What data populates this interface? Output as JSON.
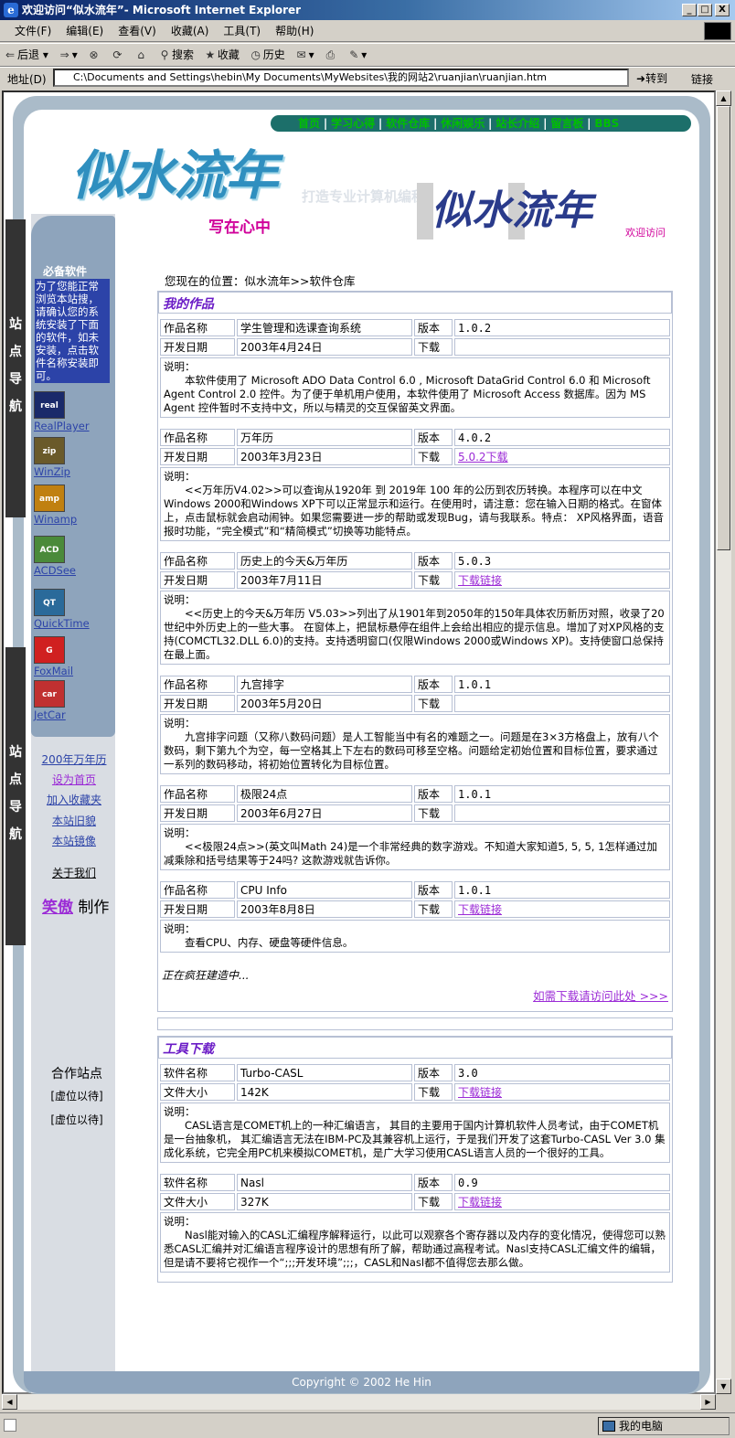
{
  "window": {
    "title": "欢迎访问“似水流年”- Microsoft Internet Explorer",
    "min": "_",
    "max": "□",
    "close": "X"
  },
  "menu": [
    "文件(F)",
    "编辑(E)",
    "查看(V)",
    "收藏(A)",
    "工具(T)",
    "帮助(H)"
  ],
  "toolbar": {
    "back": "后退",
    "search": "搜索",
    "favorites": "收藏",
    "history": "历史"
  },
  "address": {
    "label": "地址(D)",
    "value": "C:\\Documents and Settings\\hebin\\My Documents\\MyWebsites\\我的网站2\\ruanjian\\ruanjian.htm",
    "go": "转到",
    "links": "链接"
  },
  "status": {
    "zone": "我的电脑"
  },
  "site": {
    "nav": [
      "首页",
      "学习心得",
      "软件仓库",
      "休闲娱乐",
      "站长介绍",
      "留言板",
      "BBS"
    ],
    "logo": "似水流年",
    "logo_sub": "写在心中",
    "tagline": "打造专业计算机编程网站",
    "logo2": "似水流年",
    "welcome": "欢迎访问",
    "location": "您现在的位置：似水流年>>软件仓库",
    "side_tab": [
      "站",
      "点",
      "导",
      "航"
    ],
    "soft_head": "必备软件",
    "soft_desc": "为了您能正常浏览本站搜，请确认您的系统安装了下面的软件，如未安装，点击软件名称安装即可。",
    "software": [
      {
        "name": "RealPlayer",
        "icon": "real",
        "color": "#1a2a6a"
      },
      {
        "name": "WinZip",
        "icon": "zip",
        "color": "#6a5a2a"
      },
      {
        "name": "Winamp",
        "icon": "amp",
        "color": "#c08010"
      },
      {
        "name": "ACDSee",
        "icon": "ACD",
        "color": "#4a8a3a"
      },
      {
        "name": "QuickTime",
        "icon": "QT",
        "color": "#2a6a9a"
      },
      {
        "name": "FoxMail",
        "icon": "G",
        "color": "#d02020"
      },
      {
        "name": "JetCar",
        "icon": "car",
        "color": "#c03030"
      }
    ],
    "links": [
      "200年万年历",
      "设为首页",
      "加入收藏夹",
      "本站旧貌",
      "本站镜像"
    ],
    "about": "关于我们",
    "maker1": "笑傲",
    "maker2": "制作",
    "partners_head": "合作站点",
    "partners": [
      "[虚位以待]",
      "[虚位以待]"
    ],
    "labels": {
      "name": "作品名称",
      "date": "开发日期",
      "version": "版本",
      "download": "下载",
      "desc": "说明：",
      "soft": "软件名称",
      "size": "文件大小"
    },
    "works_head": "我的作品",
    "works": [
      {
        "name": "学生管理和选课查询系统",
        "version": "1.0.2",
        "date": "2003年4月24日",
        "download": "",
        "desc": "本软件使用了 Microsoft ADO Data Control 6.0 , Microsoft DataGrid Control 6.0 和 Microsoft Agent Control 2.0 控件。为了便于单机用户使用，本软件使用了 Microsoft Access 数据库。因为 MS Agent 控件暂时不支持中文，所以与精灵的交互保留英文界面。"
      },
      {
        "name": "万年历",
        "version": "4.0.2",
        "date": "2003年3月23日",
        "download": "5.0.2下载",
        "desc": "<<万年历V4.02>>可以查询从1920年 到 2019年 100 年的公历到农历转换。本程序可以在中文Windows 2000和Windows XP下可以正常显示和运行。在使用时，请注意：您在输入日期的格式。在窗体上，点击鼠标就会启动闹钟。如果您需要进一步的帮助或发现Bug，请与我联系。特点： XP风格界面，语音报时功能，“完全模式”和“精简模式”切换等功能特点。"
      },
      {
        "name": "历史上的今天&万年历",
        "version": "5.0.3",
        "date": "2003年7月11日",
        "download": "下载链接",
        "desc": "<<历史上的今天&万年历 V5.03>>列出了从1901年到2050年的150年具体农历新历对照，收录了20世纪中外历史上的一些大事。 在窗体上，把鼠标悬停在组件上会给出相应的提示信息。增加了对XP风格的支持(COMCTL32.DLL 6.0)的支持。支持透明窗口(仅限Windows 2000或Windows XP)。支持使窗口总保持在最上面。"
      },
      {
        "name": "九宫排字",
        "version": "1.0.1",
        "date": "2003年5月20日",
        "download": "",
        "desc": "九宫排字问题（又称八数码问题）是人工智能当中有名的难题之一。问题是在3×3方格盘上，放有八个数码，剩下第九个为空，每一空格其上下左右的数码可移至空格。问题给定初始位置和目标位置，要求通过一系列的数码移动，将初始位置转化为目标位置。"
      },
      {
        "name": "极限24点",
        "version": "1.0.1",
        "date": "2003年6月27日",
        "download": "",
        "desc": "<<极限24点>>(英文叫Math 24)是一个非常经典的数字游戏。不知道大家知道5, 5, 5, 1怎样通过加减乘除和括号结果等于24吗? 这款游戏就告诉你。"
      },
      {
        "name": "CPU Info",
        "version": "1.0.1",
        "date": "2003年8月8日",
        "download": "下载链接",
        "desc": "查看CPU、内存、硬盘等硬件信息。"
      }
    ],
    "building": "正在疯狂建造中...",
    "more_link": "如需下载请访问此处 >>>",
    "tools_head": "工具下载",
    "tools": [
      {
        "name": "Turbo-CASL",
        "version": "3.0",
        "size": "142K",
        "download": "下载链接",
        "desc": "CASL语言是COMET机上的一种汇编语言， 其目的主要用于国内计算机软件人员考试，由于COMET机是一台抽象机， 其汇编语言无法在IBM-PC及其兼容机上运行，于是我们开发了这套Turbo-CASL Ver 3.0 集成化系统，它完全用PC机来模拟COMET机，是广大学习使用CASL语言人员的一个很好的工具。"
      },
      {
        "name": "Nasl",
        "version": "0.9",
        "size": "327K",
        "download": "下载链接",
        "desc": "Nasl能对输入的CASL汇编程序解释运行，以此可以观察各个寄存器以及内存的变化情况，使得您可以熟悉CASL汇编并对汇编语言程序设计的思想有所了解，帮助通过高程考试。Nasl支持CASL汇编文件的编辑，但是请不要将它视作一个“;;;开发环境”;;;，CASL和Nasl都不值得您去那么做。"
      }
    ],
    "copyright": "Copyright © 2002 He Hin"
  }
}
